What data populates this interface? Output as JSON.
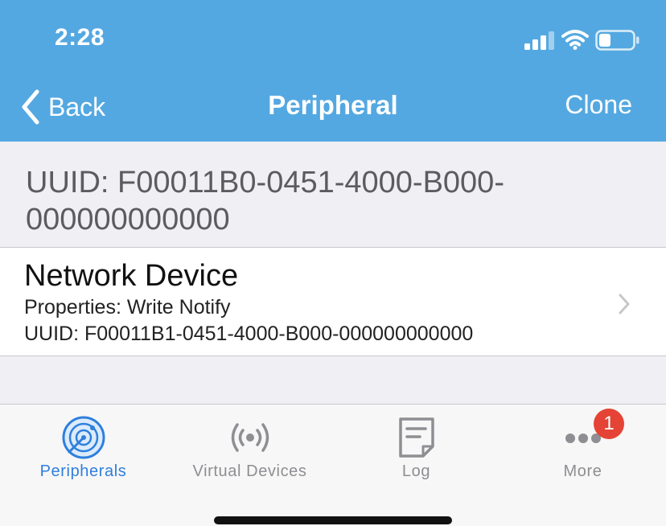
{
  "status_bar": {
    "time": "2:28"
  },
  "nav": {
    "back_label": "Back",
    "title": "Peripheral",
    "clone_label": "Clone"
  },
  "service": {
    "uuid_line": "UUID: F00011B0-0451-4000-B000-000000000000"
  },
  "characteristics": [
    {
      "name": "Network Device",
      "properties": "Properties: Write Notify",
      "uuid": "UUID: F00011B1-0451-4000-B000-000000000000"
    }
  ],
  "tabs": [
    {
      "label": "Peripherals",
      "icon": "radar-icon",
      "active": true
    },
    {
      "label": "Virtual Devices",
      "icon": "broadcast-icon",
      "active": false
    },
    {
      "label": "Log",
      "icon": "log-document-icon",
      "active": false
    },
    {
      "label": "More",
      "icon": "more-dots-icon",
      "active": false,
      "badge": "1"
    }
  ],
  "colors": {
    "header_blue": "#54a8e1",
    "active_tab": "#2e7fdc",
    "inactive_tab": "#8e8e93",
    "badge_red": "#e54335"
  }
}
